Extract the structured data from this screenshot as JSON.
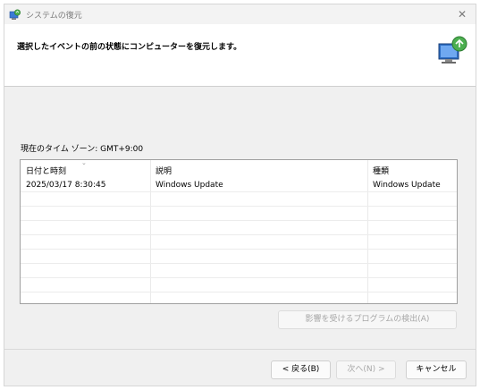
{
  "window": {
    "title": "システムの復元",
    "close_glyph": "✕",
    "title_icon": "system-restore-icon"
  },
  "header": {
    "instruction": "選択したイベントの前の状態にコンピューターを復元します。",
    "icon": "system-restore-computer-icon"
  },
  "timezone_label": "現在のタイム ゾーン: GMT+9:00",
  "table": {
    "columns": [
      "日付と時刻",
      "説明",
      "種類"
    ],
    "sort_glyph": "⌄",
    "rows": [
      [
        "2025/03/17 8:30:45",
        "Windows Update",
        "Windows Update"
      ]
    ]
  },
  "buttons": {
    "scan": "影響を受けるプログラムの検出(A)",
    "back": "< 戻る(B)",
    "next": "次へ(N) >",
    "cancel": "キャンセル"
  }
}
